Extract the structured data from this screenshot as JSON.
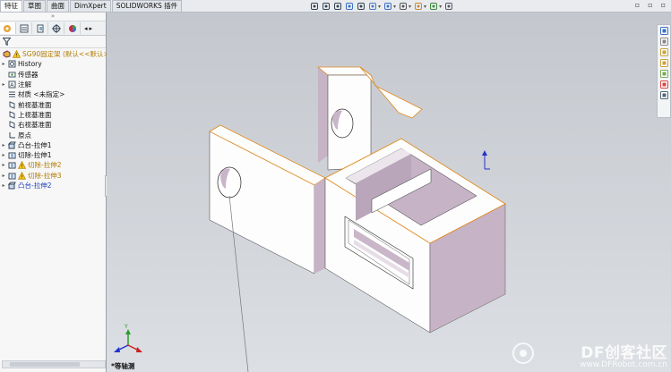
{
  "command_tabs": [
    {
      "label": "特征",
      "active": true
    },
    {
      "label": "草图",
      "active": false
    },
    {
      "label": "曲面",
      "active": false
    },
    {
      "label": "DimXpert",
      "active": false
    },
    {
      "label": "SOLIDWORKS 插件",
      "active": false
    }
  ],
  "hud_icons": [
    "zoom-to-fit-icon",
    "zoom-area-icon",
    "previous-view-icon",
    "section-view-icon",
    "dynamic-annotation-icon",
    "view-orientation-icon",
    "display-style-icon",
    "hide-show-icon",
    "edit-appearance-icon",
    "apply-scene-icon",
    "view-settings-icon"
  ],
  "feature_manager": {
    "tabs": [
      "feature-manager-icon",
      "property-manager-icon",
      "configuration-manager-icon",
      "dimxpert-manager-icon",
      "display-manager-icon"
    ],
    "tree": [
      {
        "label": "SG90固定架  (默认<<默认>_",
        "icon": "part-icon",
        "warning": true,
        "expand": "",
        "root": true
      },
      {
        "label": "History",
        "icon": "history-icon",
        "expand": "▸"
      },
      {
        "label": "传感器",
        "icon": "sensor-icon",
        "expand": ""
      },
      {
        "label": "注解",
        "icon": "annotation-icon",
        "expand": "▸"
      },
      {
        "label": "材质 <未指定>",
        "icon": "material-icon",
        "expand": ""
      },
      {
        "label": "前视基准面",
        "icon": "plane-icon",
        "expand": ""
      },
      {
        "label": "上视基准面",
        "icon": "plane-icon",
        "expand": ""
      },
      {
        "label": "右视基准面",
        "icon": "plane-icon",
        "expand": ""
      },
      {
        "label": "原点",
        "icon": "origin-icon",
        "expand": ""
      },
      {
        "label": "凸台-拉伸1",
        "icon": "boss-extrude-icon",
        "expand": "▸"
      },
      {
        "label": "切除-拉伸1",
        "icon": "cut-extrude-icon",
        "expand": "▸"
      },
      {
        "label": "切除-拉伸2",
        "icon": "cut-extrude-icon",
        "warning": true,
        "expand": "▸"
      },
      {
        "label": "切除-拉伸3",
        "icon": "cut-extrude-icon",
        "warning": true,
        "expand": "▸"
      },
      {
        "label": "凸台-拉伸2",
        "icon": "boss-extrude-icon",
        "expand": "▸",
        "selected": true
      }
    ]
  },
  "viewport": {
    "view_name": "*等轴测"
  },
  "task_pane": [
    "home-icon",
    "resources-icon",
    "design-library-icon",
    "file-explorer-icon",
    "view-palette-icon",
    "appearances-icon",
    "custom-properties-icon"
  ],
  "watermark": {
    "main": "DF创客社区",
    "url": "www.DFRobot.com.cn"
  },
  "colors": {
    "part_face": "#fefefe",
    "part_side": "#c6b3c6",
    "part_edge": "#e08a1e",
    "viewport_top": "#c4c7cd",
    "viewport_bottom": "#dcdfe3"
  }
}
